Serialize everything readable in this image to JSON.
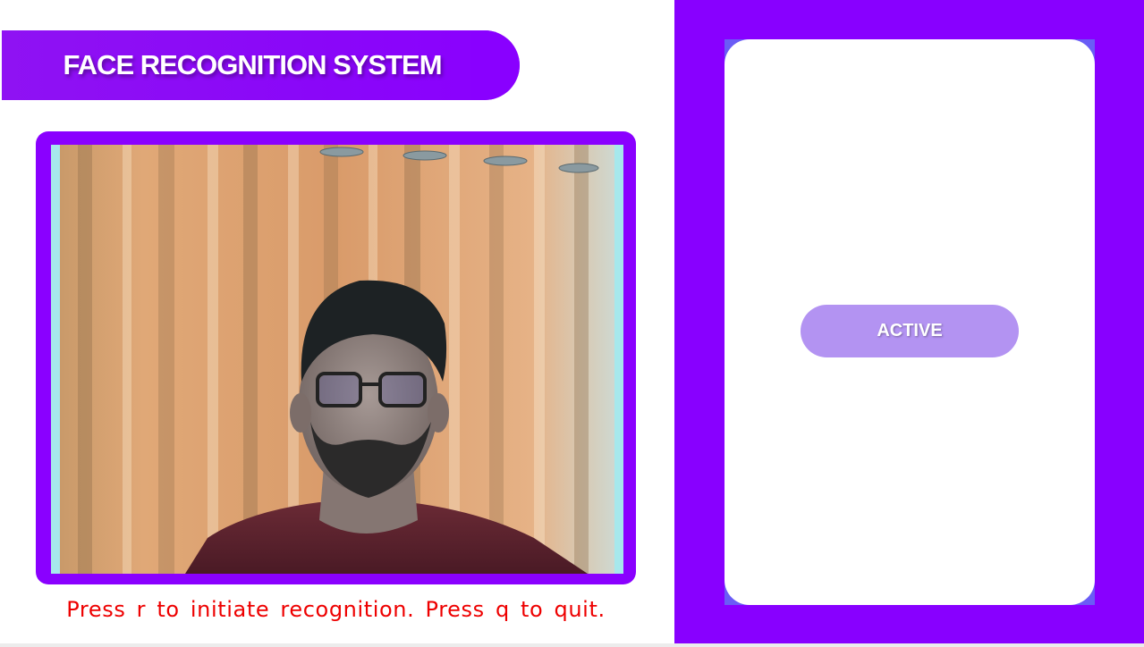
{
  "header": {
    "title": "FACE RECOGNITION SYSTEM"
  },
  "camera": {
    "feed_label": "webcam-feed"
  },
  "footer": {
    "instructions": "Press r to initiate recognition. Press q to quit."
  },
  "status": {
    "label": "ACTIVE"
  },
  "colors": {
    "accent": "#8a00ff",
    "badge": "#b393f2",
    "instructions_text": "#ee0000",
    "card_border": "#6a5cf6"
  }
}
